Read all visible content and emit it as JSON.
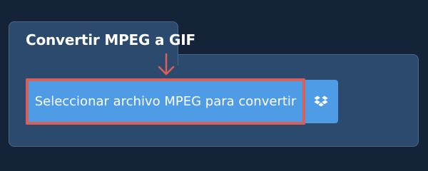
{
  "converter": {
    "tab_title": "Convertir MPEG a GIF",
    "select_button_label": "Seleccionar archivo MPEG para convertir",
    "dropbox_icon": "dropbox-icon",
    "annotation_icon": "arrow-down-icon"
  },
  "colors": {
    "page_background": "#142337",
    "panel_background": "#2b4a6e",
    "button_background": "#4e9be6",
    "highlight_border": "#d9605a",
    "text": "#ffffff"
  }
}
